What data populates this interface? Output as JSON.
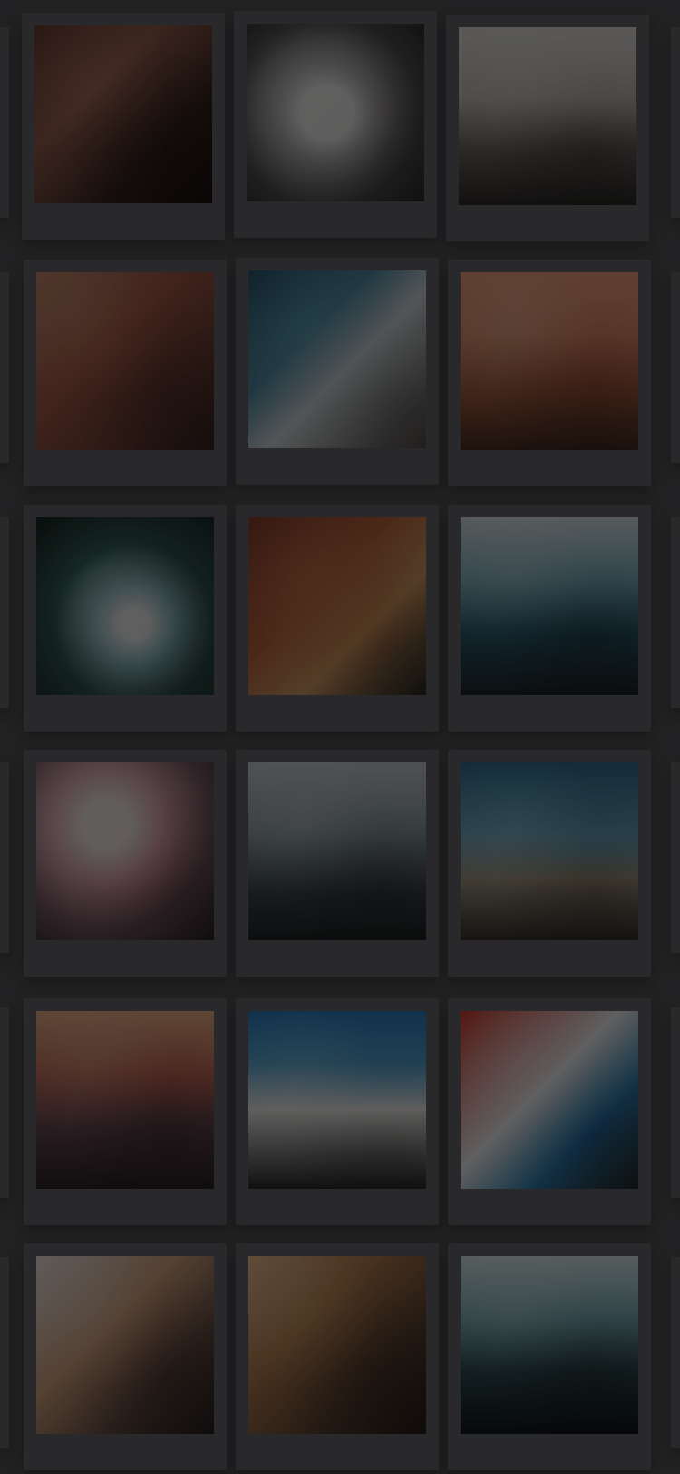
{
  "screen": {
    "title": "",
    "tiles": [
      {
        "image": "photo-1",
        "caption": ""
      },
      {
        "image": "photo-2",
        "caption": ""
      },
      {
        "image": "photo-3",
        "caption": ""
      },
      {
        "image": "photo-4",
        "caption": ""
      },
      {
        "image": "photo-5",
        "caption": ""
      },
      {
        "image": "photo-6",
        "caption": ""
      },
      {
        "image": "photo-7",
        "caption": ""
      },
      {
        "image": "photo-8",
        "caption": ""
      },
      {
        "image": "photo-9",
        "caption": ""
      },
      {
        "image": "photo-10",
        "caption": ""
      },
      {
        "image": "photo-11",
        "caption": ""
      },
      {
        "image": "photo-12",
        "caption": ""
      },
      {
        "image": "photo-13",
        "caption": ""
      },
      {
        "image": "photo-14",
        "caption": ""
      },
      {
        "image": "photo-15",
        "caption": ""
      },
      {
        "image": "photo-16",
        "caption": ""
      },
      {
        "image": "photo-17",
        "caption": ""
      },
      {
        "image": "photo-18",
        "caption": ""
      }
    ]
  }
}
